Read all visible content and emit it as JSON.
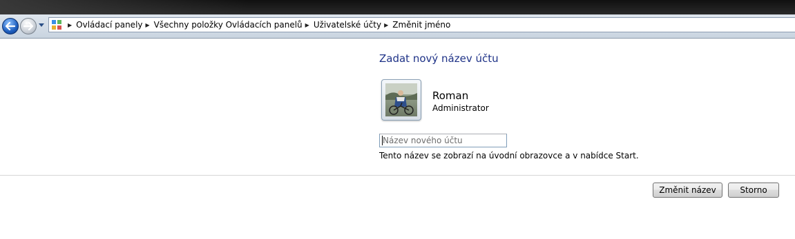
{
  "window": {
    "title": "Změnit jméno"
  },
  "address_bar": {
    "crumbs": [
      "Ovládací panely",
      "Všechny položky Ovládacích panelů",
      "Uživatelské účty",
      "Změnit jméno"
    ]
  },
  "icons": {
    "back": "back-arrow-icon",
    "forward": "forward-arrow-icon",
    "history": "chevron-down-icon",
    "control_panel": "control-panel-icon",
    "crumb_separator": "chevron-right-icon"
  },
  "main": {
    "heading": "Zadat nový název účtu",
    "user": {
      "name": "Roman",
      "role": "Administrator"
    },
    "name_input": {
      "value": "",
      "placeholder": "Název nového účtu"
    },
    "hint": "Tento název se zobrazí na úvodní obrazovce a v nabídce Start."
  },
  "buttons": {
    "change_name": "Změnit název",
    "cancel": "Storno"
  },
  "colors": {
    "heading": "#1e3287",
    "back_button": "#1f5fbf",
    "divider": "#d5d5d5"
  }
}
